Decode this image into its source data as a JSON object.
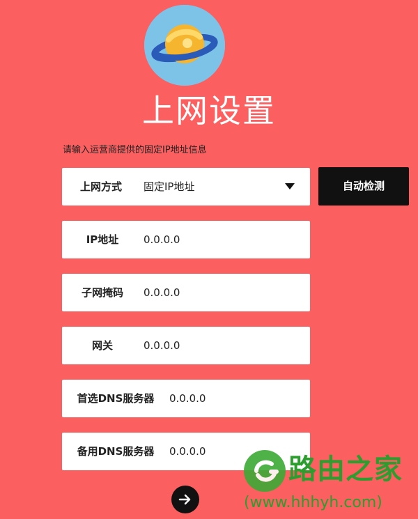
{
  "page": {
    "title": "上网设置",
    "hint": "请输入运营商提供的固定IP地址信息"
  },
  "form": {
    "connection_type": {
      "label": "上网方式",
      "value": "固定IP地址"
    },
    "ip_address": {
      "label": "IP地址",
      "value": "0.0.0.0"
    },
    "subnet_mask": {
      "label": "子网掩码",
      "value": "0.0.0.0"
    },
    "gateway": {
      "label": "网关",
      "value": "0.0.0.0"
    },
    "primary_dns": {
      "label": "首选DNS服务器",
      "value": "0.0.0.0"
    },
    "secondary_dns": {
      "label": "备用DNS服务器",
      "value": "0.0.0.0"
    }
  },
  "buttons": {
    "auto_detect": "自动检测",
    "next_icon": "arrow-right-icon"
  },
  "watermark": {
    "title": "路由之家",
    "url": "(www.hhhyh.com)"
  },
  "colors": {
    "background": "#FB5F60",
    "logo_circle": "#7DC3E8",
    "planet": "#F6B52E",
    "ring": "#2B5BB8",
    "button": "#111111",
    "field": "#FFFFFF",
    "watermark": "#2E9D2F"
  },
  "icons": {
    "logo": "planet-logo-icon",
    "dropdown": "caret-down-icon",
    "watermark": "router-home-logo-icon"
  }
}
